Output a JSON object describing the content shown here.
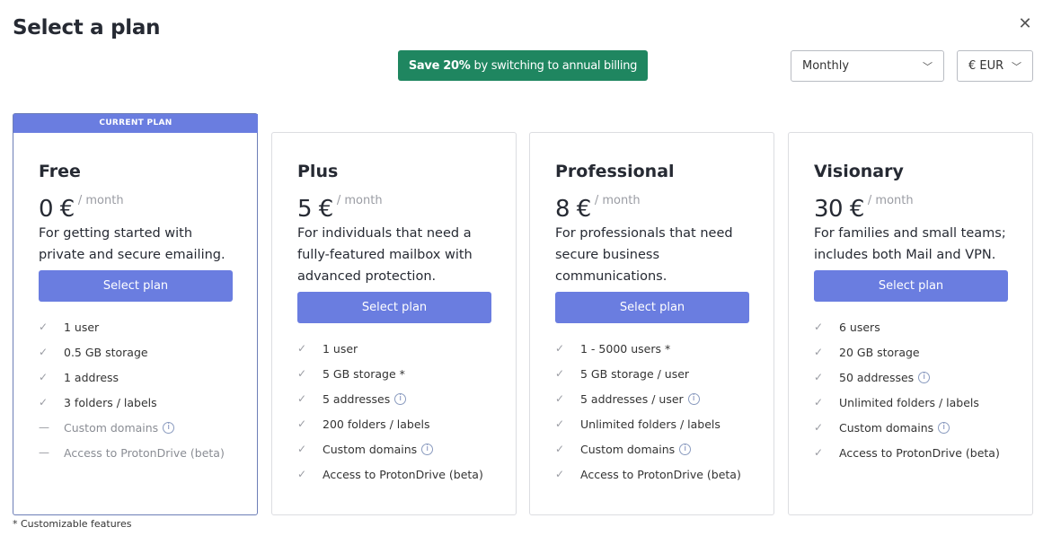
{
  "title": "Select a plan",
  "promo": {
    "bold": "Save 20%",
    "text": "by switching to annual billing",
    "color": "#1f8660"
  },
  "billing_cycle": "Monthly",
  "currency": "€ EUR",
  "accent": "#6a7de0",
  "current_plan_label": "CURRENT PLAN",
  "plans": [
    {
      "name": "Free",
      "price": "0 €",
      "per": "/ month",
      "desc": "For getting started with private and secure emailing.",
      "button": "Select plan",
      "current": true,
      "features": [
        {
          "t": "1 user",
          "on": true
        },
        {
          "t": "0.5 GB storage",
          "on": true
        },
        {
          "t": "1 address",
          "on": true
        },
        {
          "t": "3 folders / labels",
          "on": true
        },
        {
          "t": "Custom domains",
          "on": false,
          "info": true
        },
        {
          "t": "Access to ProtonDrive (beta)",
          "on": false
        }
      ]
    },
    {
      "name": "Plus",
      "price": "5 €",
      "per": "/ month",
      "desc": "For individuals that need a fully-featured mailbox with advanced protection.",
      "button": "Select plan",
      "features": [
        {
          "t": "1 user",
          "on": true
        },
        {
          "t": "5 GB storage *",
          "on": true
        },
        {
          "t": "5 addresses",
          "on": true,
          "info": true
        },
        {
          "t": "200 folders / labels",
          "on": true
        },
        {
          "t": "Custom domains",
          "on": true,
          "info": true
        },
        {
          "t": "Access to ProtonDrive (beta)",
          "on": true
        }
      ]
    },
    {
      "name": "Professional",
      "price": "8 €",
      "per": "/ month",
      "desc": "For professionals that need secure business communications.",
      "button": "Select plan",
      "features": [
        {
          "t": "1 - 5000 users *",
          "on": true
        },
        {
          "t": "5 GB storage / user",
          "on": true
        },
        {
          "t": "5 addresses / user",
          "on": true,
          "info": true
        },
        {
          "t": "Unlimited folders / labels",
          "on": true
        },
        {
          "t": "Custom domains",
          "on": true,
          "info": true
        },
        {
          "t": "Access to ProtonDrive (beta)",
          "on": true
        }
      ]
    },
    {
      "name": "Visionary",
      "price": "30 €",
      "per": "/ month",
      "desc": "For families and small teams; includes both Mail and VPN.",
      "button": "Select plan",
      "features": [
        {
          "t": "6 users",
          "on": true
        },
        {
          "t": "20 GB storage",
          "on": true
        },
        {
          "t": "50 addresses",
          "on": true,
          "info": true
        },
        {
          "t": "Unlimited folders / labels",
          "on": true
        },
        {
          "t": "Custom domains",
          "on": true,
          "info": true
        },
        {
          "t": "Access to ProtonDrive (beta)",
          "on": true
        }
      ]
    }
  ],
  "footnote": "* Customizable features"
}
